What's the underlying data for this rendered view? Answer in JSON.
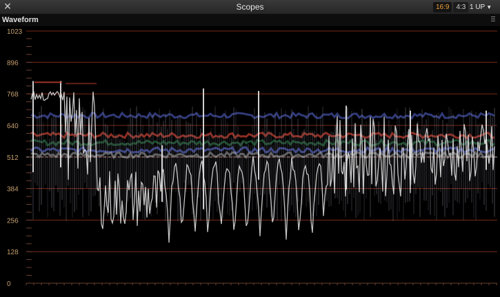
{
  "window": {
    "title": "Scopes",
    "close_icon": "close-icon"
  },
  "toolbar": {
    "aspect_options": [
      {
        "label": "16:9",
        "active": true
      },
      {
        "label": "4:3",
        "active": false
      }
    ],
    "layout_select": "1 UP"
  },
  "scope_panel": {
    "title": "Waveform",
    "options_icon": "hamburger-menu-icon"
  },
  "chart_data": {
    "type": "waveform",
    "y_ticks": [
      "1023",
      "896",
      "768",
      "640",
      "512",
      "384",
      "256",
      "128",
      "0"
    ],
    "ylim": [
      0,
      1023
    ],
    "grid": true,
    "dashed_reference_level": 512,
    "colors": {
      "gridline": "#7a2a1a",
      "tick_label": "#c7a070",
      "trace_white": "#e8e8e8",
      "trace_blue": "#5a6ad8",
      "trace_red": "#c84030",
      "trace_green": "#3aa060"
    }
  }
}
